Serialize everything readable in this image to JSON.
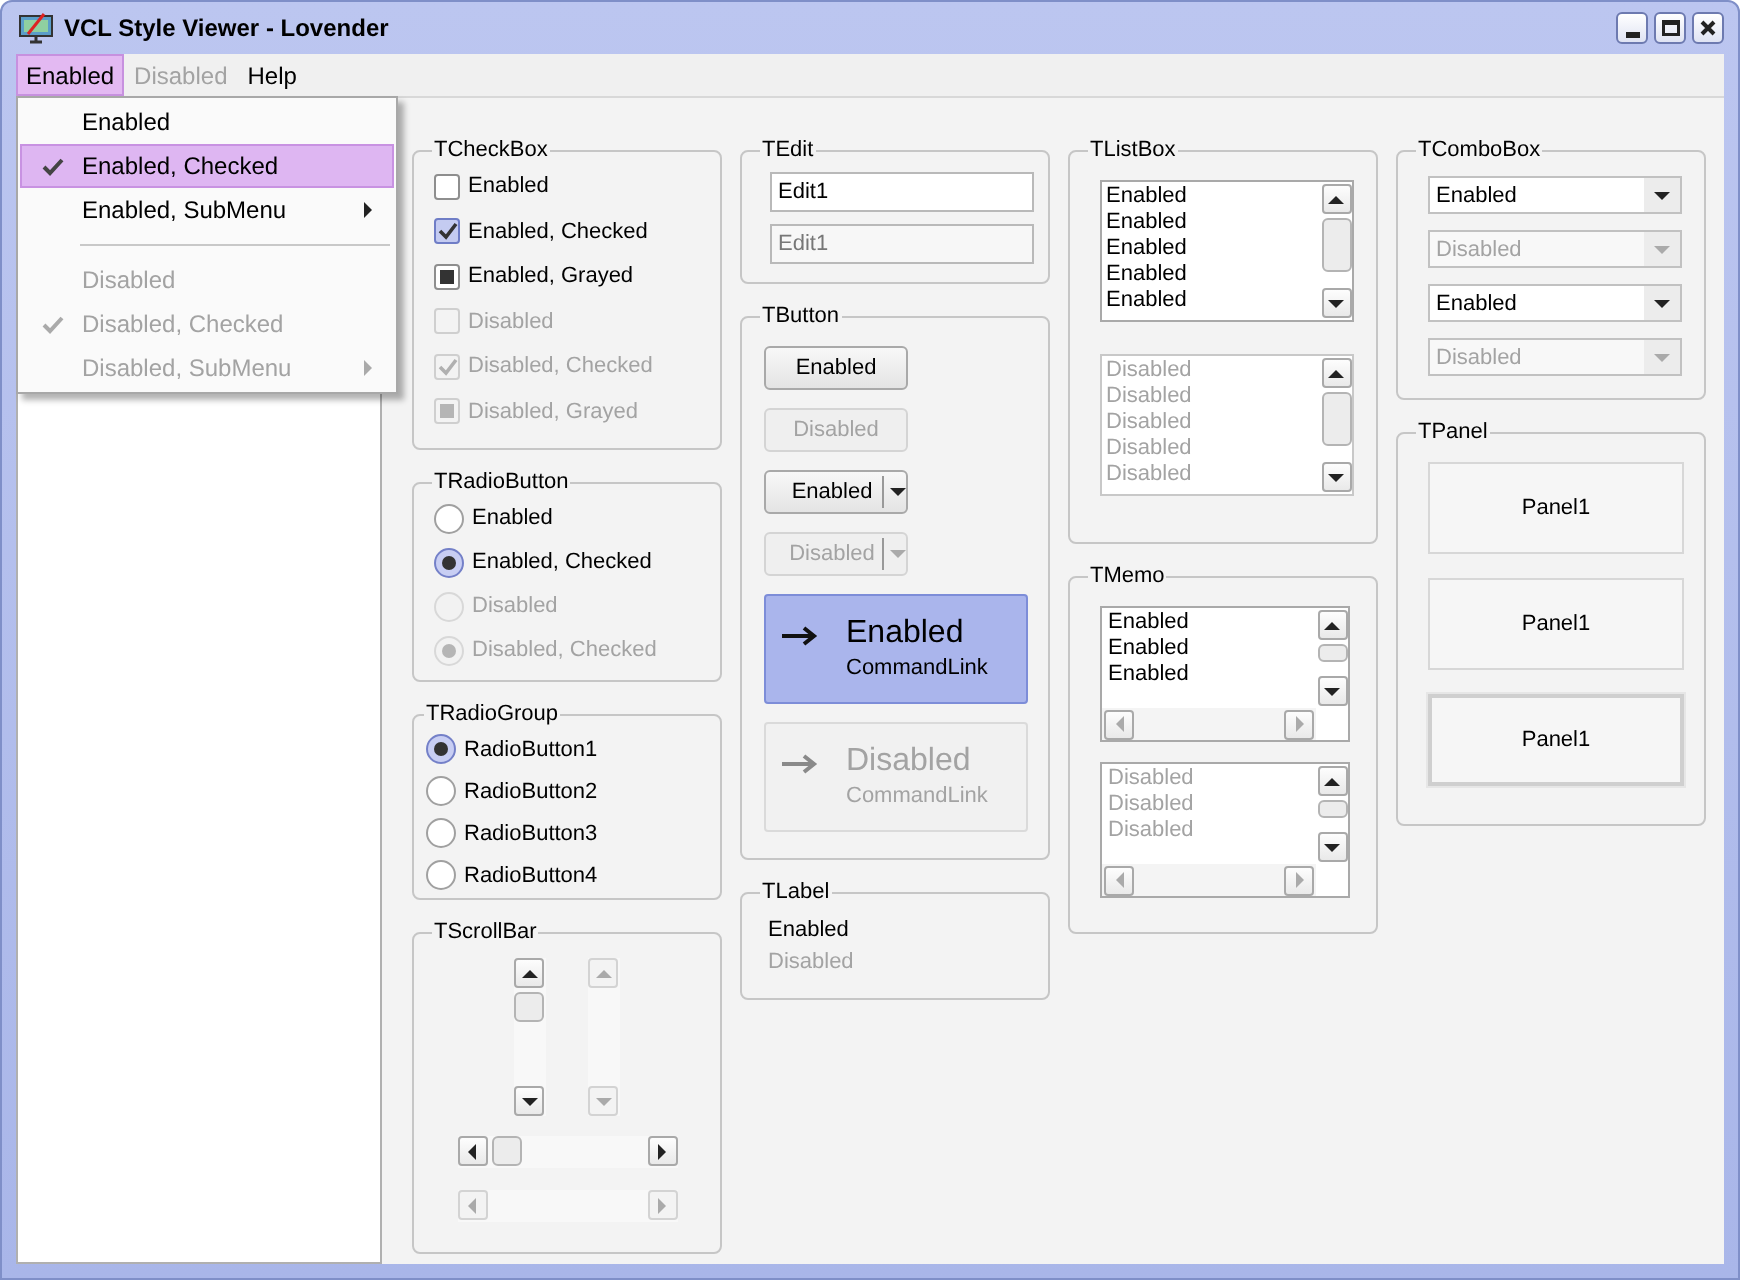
{
  "window": {
    "title": "VCL Style Viewer - Lovender"
  },
  "menu_bar": [
    {
      "label": "Enabled",
      "selected": true,
      "disabled": false
    },
    {
      "label": "Disabled",
      "selected": false,
      "disabled": true
    },
    {
      "label": "Help",
      "selected": false,
      "disabled": false
    }
  ],
  "menu_dropdown": [
    {
      "kind": "item",
      "label": "Enabled",
      "checked": false,
      "disabled": false,
      "submenu": false,
      "selected": false
    },
    {
      "kind": "item",
      "label": "Enabled, Checked",
      "checked": true,
      "disabled": false,
      "submenu": false,
      "selected": true
    },
    {
      "kind": "item",
      "label": "Enabled, SubMenu",
      "checked": false,
      "disabled": false,
      "submenu": true,
      "selected": false
    },
    {
      "kind": "separator"
    },
    {
      "kind": "item",
      "label": "Disabled",
      "checked": false,
      "disabled": true,
      "submenu": false,
      "selected": false
    },
    {
      "kind": "item",
      "label": "Disabled, Checked",
      "checked": true,
      "disabled": true,
      "submenu": false,
      "selected": false
    },
    {
      "kind": "item",
      "label": "Disabled, SubMenu",
      "checked": false,
      "disabled": true,
      "submenu": true,
      "selected": false
    }
  ],
  "columns": [
    {
      "groups": [
        {
          "kind": "checkbox",
          "title": "TCheckBox",
          "items": [
            {
              "label": "Enabled",
              "checked": false,
              "grayed": false,
              "disabled": false
            },
            {
              "label": "Enabled, Checked",
              "checked": true,
              "grayed": false,
              "disabled": false
            },
            {
              "label": "Enabled, Grayed",
              "checked": false,
              "grayed": true,
              "disabled": false
            },
            {
              "label": "Disabled",
              "checked": false,
              "grayed": false,
              "disabled": true
            },
            {
              "label": "Disabled, Checked",
              "checked": true,
              "grayed": false,
              "disabled": true
            },
            {
              "label": "Disabled, Grayed",
              "checked": false,
              "grayed": true,
              "disabled": true
            }
          ]
        },
        {
          "kind": "radio",
          "title": "TRadioButton",
          "items": [
            {
              "label": "Enabled",
              "checked": false,
              "disabled": false
            },
            {
              "label": "Enabled, Checked",
              "checked": true,
              "disabled": false
            },
            {
              "label": "Disabled",
              "checked": false,
              "disabled": true
            },
            {
              "label": "Disabled, Checked",
              "checked": true,
              "disabled": true
            }
          ]
        },
        {
          "kind": "radiogroup",
          "title": "TRadioGroup",
          "items": [
            {
              "label": "RadioButton1",
              "selected": true
            },
            {
              "label": "RadioButton2",
              "selected": false
            },
            {
              "label": "RadioButton3",
              "selected": false
            },
            {
              "label": "RadioButton4",
              "selected": false
            }
          ]
        },
        {
          "kind": "scrollbar",
          "title": "TScrollBar",
          "items": [
            {
              "kind": "vertical",
              "disabled": false
            },
            {
              "kind": "vertical",
              "disabled": true
            },
            {
              "kind": "horizontal",
              "disabled": false
            },
            {
              "kind": "horizontal",
              "disabled": true
            }
          ]
        }
      ]
    },
    {
      "groups": [
        {
          "kind": "edit",
          "title": "TEdit",
          "items": [
            {
              "value": "Edit1",
              "disabled": false
            },
            {
              "value": "Edit1",
              "disabled": true
            }
          ]
        },
        {
          "kind": "button",
          "title": "TButton",
          "items": [
            {
              "kind": "push",
              "label": "Enabled",
              "disabled": false
            },
            {
              "kind": "push",
              "label": "Disabled",
              "disabled": true
            },
            {
              "kind": "split",
              "label": "Enabled",
              "disabled": false
            },
            {
              "kind": "split",
              "label": "Disabled",
              "disabled": true
            },
            {
              "kind": "command_link",
              "label": "Enabled",
              "note": "CommandLink",
              "disabled": false
            },
            {
              "kind": "command_link",
              "label": "Disabled",
              "note": "CommandLink",
              "disabled": true
            }
          ]
        },
        {
          "kind": "label",
          "title": "TLabel",
          "items": [
            {
              "text": "Enabled",
              "disabled": false
            },
            {
              "text": "Disabled",
              "disabled": true
            }
          ]
        }
      ]
    },
    {
      "groups": [
        {
          "kind": "listbox",
          "title": "TListBox",
          "items": [
            {
              "disabled": false,
              "lines": [
                "Enabled",
                "Enabled",
                "Enabled",
                "Enabled",
                "Enabled"
              ]
            },
            {
              "disabled": true,
              "lines": [
                "Disabled",
                "Disabled",
                "Disabled",
                "Disabled",
                "Disabled"
              ]
            }
          ]
        },
        {
          "kind": "memo",
          "title": "TMemo",
          "items": [
            {
              "disabled": false,
              "lines": [
                "Enabled",
                "Enabled",
                "Enabled"
              ]
            },
            {
              "disabled": true,
              "lines": [
                "Disabled",
                "Disabled",
                "Disabled"
              ]
            }
          ]
        }
      ]
    },
    {
      "groups": [
        {
          "kind": "combobox",
          "title": "TComboBox",
          "items": [
            {
              "value": "Enabled",
              "disabled": false
            },
            {
              "value": "Disabled",
              "disabled": true
            },
            {
              "value": "Enabled",
              "disabled": false
            },
            {
              "value": "Disabled",
              "disabled": true
            }
          ]
        },
        {
          "kind": "panel",
          "title": "TPanel",
          "items": [
            {
              "caption": "Panel1",
              "kind": "flat"
            },
            {
              "caption": "Panel1",
              "kind": "flat"
            },
            {
              "caption": "Panel1",
              "kind": "raised"
            }
          ]
        }
      ]
    }
  ]
}
